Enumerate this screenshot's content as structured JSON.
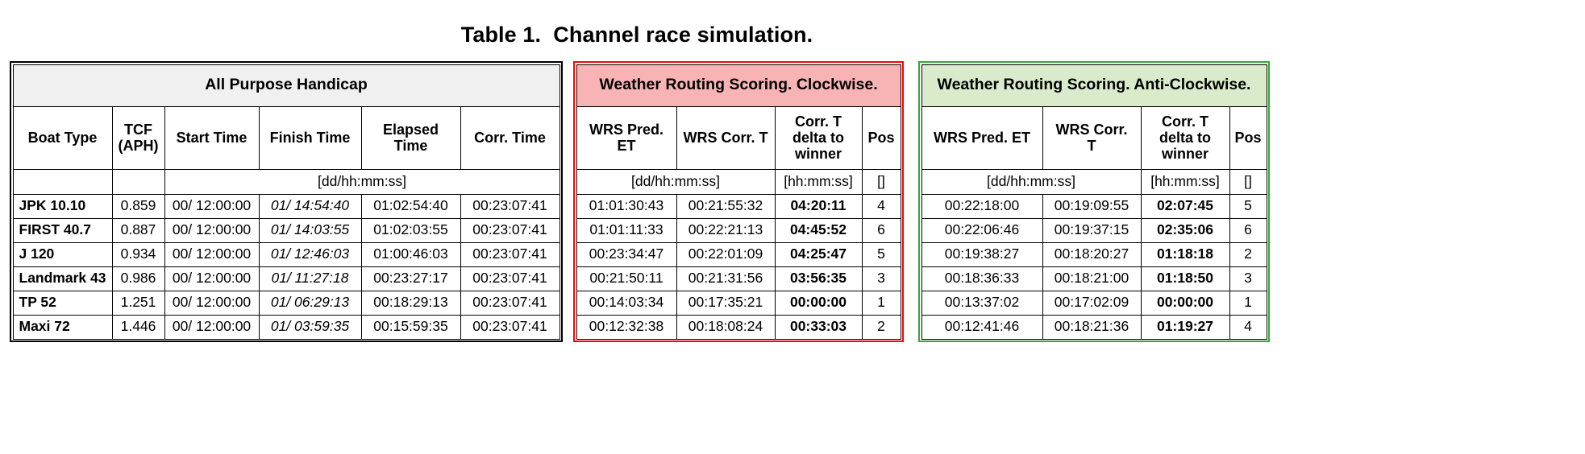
{
  "title": "Table 1.  Channel race simulation.",
  "tables": [
    {
      "id": "all-purpose-handicap",
      "banner": "All Purpose Handicap",
      "banner_bg": "#f0f0f0",
      "frame_color": "#000000",
      "columns": [
        "Boat Type",
        "TCF\n(APH)",
        "Start Time",
        "Finish Time",
        "Elapsed\nTime",
        "Corr. Time"
      ],
      "units": [
        "",
        "",
        "[dd/hh:mm:ss]"
      ],
      "rows": [
        [
          "JPK 10.10",
          "0.859",
          "00/ 12:00:00",
          "01/ 14:54:40",
          "01:02:54:40",
          "00:23:07:41"
        ],
        [
          "FIRST 40.7",
          "0.887",
          "00/ 12:00:00",
          "01/ 14:03:55",
          "01:02:03:55",
          "00:23:07:41"
        ],
        [
          "J 120",
          "0.934",
          "00/ 12:00:00",
          "01/ 12:46:03",
          "01:00:46:03",
          "00:23:07:41"
        ],
        [
          "Landmark 43",
          "0.986",
          "00/ 12:00:00",
          "01/ 11:27:18",
          "00:23:27:17",
          "00:23:07:41"
        ],
        [
          "TP 52",
          "1.251",
          "00/ 12:00:00",
          "01/ 06:29:13",
          "00:18:29:13",
          "00:23:07:41"
        ],
        [
          "Maxi 72",
          "1.446",
          "00/ 12:00:00",
          "01/ 03:59:35",
          "00:15:59:35",
          "00:23:07:41"
        ]
      ]
    },
    {
      "id": "wrs-clockwise",
      "banner": "Weather Routing Scoring. Clockwise.",
      "banner_bg": "#f8b4b4",
      "frame_color": "#ff0000",
      "columns": [
        "WRS Pred.\nET",
        "WRS Corr. T",
        "Corr. T\ndelta to\nwinner",
        "Pos"
      ],
      "units": [
        "[dd/hh:mm:ss]",
        "[hh:mm:ss]",
        "[]"
      ],
      "rows": [
        [
          "01:01:30:43",
          "00:21:55:32",
          "04:20:11",
          "4"
        ],
        [
          "01:01:11:33",
          "00:22:21:13",
          "04:45:52",
          "6"
        ],
        [
          "00:23:34:47",
          "00:22:01:09",
          "04:25:47",
          "5"
        ],
        [
          "00:21:50:11",
          "00:21:31:56",
          "03:56:35",
          "3"
        ],
        [
          "00:14:03:34",
          "00:17:35:21",
          "00:00:00",
          "1"
        ],
        [
          "00:12:32:38",
          "00:18:08:24",
          "00:33:03",
          "2"
        ]
      ]
    },
    {
      "id": "wrs-anti-clockwise",
      "banner": "Weather Routing Scoring. Anti-Clockwise.",
      "banner_bg": "#d9ebcb",
      "frame_color": "#33aa33",
      "columns": [
        "WRS Pred. ET",
        "WRS Corr.\nT",
        "Corr. T\ndelta to\nwinner",
        "Pos"
      ],
      "units": [
        "[dd/hh:mm:ss]",
        "[hh:mm:ss]",
        "[]"
      ],
      "rows": [
        [
          "00:22:18:00",
          "00:19:09:55",
          "02:07:45",
          "5"
        ],
        [
          "00:22:06:46",
          "00:19:37:15",
          "02:35:06",
          "6"
        ],
        [
          "00:19:38:27",
          "00:18:20:27",
          "01:18:18",
          "2"
        ],
        [
          "00:18:36:33",
          "00:18:21:00",
          "01:18:50",
          "3"
        ],
        [
          "00:13:37:02",
          "00:17:02:09",
          "00:00:00",
          "1"
        ],
        [
          "00:12:41:46",
          "00:18:21:36",
          "01:19:27",
          "4"
        ]
      ]
    }
  ]
}
